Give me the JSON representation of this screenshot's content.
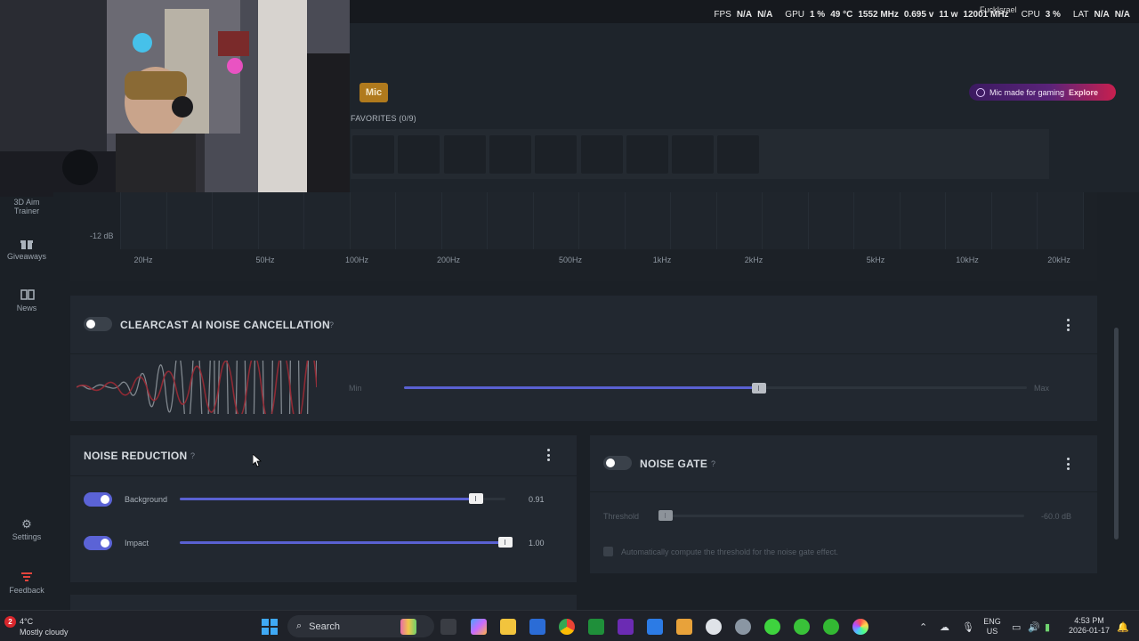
{
  "overlay": {
    "user": "FuckIsrael",
    "fps_label": "FPS",
    "fps_value1": "N/A",
    "fps_value2": "N/A",
    "gpu_label": "GPU",
    "gpu_pct": "1 %",
    "gpu_temp": "49 °C",
    "gpu_clock": "1552 MHz",
    "gpu_volt": "0.695 v",
    "gpu_watt": "11 w",
    "gpu_mem": "12001 MHz",
    "cpu_label": "CPU",
    "cpu_pct": "3 %",
    "lat_label": "LAT",
    "lat_value1": "N/A",
    "lat_value2": "N/A"
  },
  "header": {
    "device_badge": "Mic",
    "favorites_label": "FAVORITES (0/9)",
    "favorite_slot_count": 9,
    "promo_text": "Mic made for gaming",
    "promo_link": "Explore"
  },
  "sidebar": {
    "items": [
      {
        "label": "3D Aim Trainer",
        "label_line1": "3D Aim",
        "label_line2": "Trainer",
        "icon": "crosshair-icon"
      },
      {
        "label": "Giveaways",
        "icon": "gift-icon"
      },
      {
        "label": "News",
        "icon": "book-icon"
      },
      {
        "label": "Settings",
        "icon": "gear-icon"
      },
      {
        "label": "Feedback",
        "icon": "feedback-icon"
      }
    ]
  },
  "equalizer": {
    "db_label": "-12 dB",
    "frequencies": [
      "20Hz",
      "50Hz",
      "100Hz",
      "200Hz",
      "500Hz",
      "1kHz",
      "2kHz",
      "5kHz",
      "10kHz",
      "20kHz"
    ]
  },
  "clearcast": {
    "title": "CLEARCAST AI NOISE CANCELLATION",
    "help": "?",
    "enabled": false,
    "min_label": "Min",
    "max_label": "Max",
    "level_fraction": 0.57
  },
  "noise_reduction": {
    "title": "NOISE REDUCTION",
    "help": "?",
    "rows": [
      {
        "label": "Background",
        "enabled": true,
        "value": "0.91",
        "fraction": 0.91
      },
      {
        "label": "Impact",
        "enabled": true,
        "value": "1.00",
        "fraction": 1.0
      }
    ]
  },
  "noise_gate": {
    "title": "NOISE GATE",
    "help": "?",
    "enabled": false,
    "threshold_label": "Threshold",
    "threshold_value": "-60.0 dB",
    "auto_compute_label": "Automatically compute the threshold for the noise gate effect.",
    "auto_compute_checked": false
  },
  "taskbar": {
    "weather_temp": "4°C",
    "weather_desc": "Mostly cloudy",
    "weather_badge": "2",
    "search_placeholder": "Search",
    "lang_line1": "ENG",
    "lang_line2": "US",
    "time": "4:53 PM",
    "date": "2026-01-17"
  },
  "colors": {
    "accent": "#5a61d2",
    "mic_badge": "#b07a1d",
    "background": "#1b2026",
    "panel": "#222830"
  }
}
